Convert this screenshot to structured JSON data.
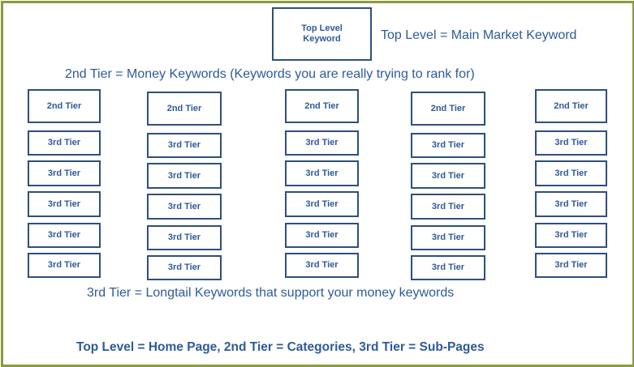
{
  "top_box": {
    "line1": "Top Level",
    "line2": "Keyword"
  },
  "captions": {
    "top_level": "Top Level = Main Market Keyword",
    "tier2": "2nd Tier = Money Keywords (Keywords you are really trying to rank for)",
    "tier3": "3rd Tier = Longtail Keywords that support your money keywords",
    "summary": "Top Level = Home Page, 2nd Tier = Categories, 3rd Tier = Sub-Pages"
  },
  "columns": [
    {
      "tier2": "2nd Tier",
      "tier3": [
        "3rd Tier",
        "3rd Tier",
        "3rd Tier",
        "3rd Tier",
        "3rd Tier"
      ]
    },
    {
      "tier2": "2nd Tier",
      "tier3": [
        "3rd Tier",
        "3rd Tier",
        "3rd Tier",
        "3rd Tier",
        "3rd Tier"
      ]
    },
    {
      "tier2": "2nd Tier",
      "tier3": [
        "3rd Tier",
        "3rd Tier",
        "3rd Tier",
        "3rd Tier",
        "3rd Tier"
      ]
    },
    {
      "tier2": "2nd Tier",
      "tier3": [
        "3rd Tier",
        "3rd Tier",
        "3rd Tier",
        "3rd Tier",
        "3rd Tier"
      ]
    },
    {
      "tier2": "2nd Tier",
      "tier3": [
        "3rd Tier",
        "3rd Tier",
        "3rd Tier",
        "3rd Tier",
        "3rd Tier"
      ]
    }
  ],
  "colors": {
    "border": "#8a9a3e",
    "box_border": "#2f4f7f",
    "text": "#2e5a9a"
  }
}
